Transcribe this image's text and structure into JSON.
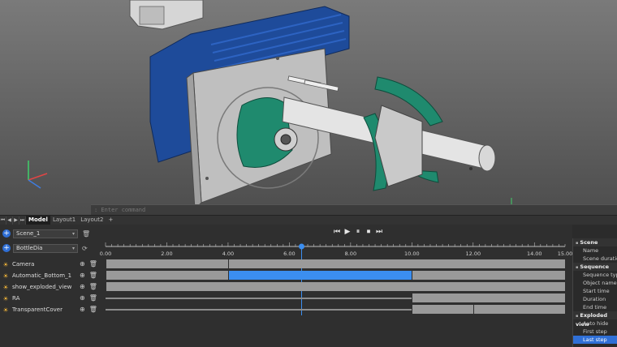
{
  "command_line": {
    "placeholder": ": Enter command"
  },
  "layout_tabs": {
    "nav": [
      "⏮",
      "◀",
      "▶",
      "⏭"
    ],
    "items": [
      "Model",
      "Layout1",
      "Layout2",
      "+"
    ]
  },
  "scene_selector": {
    "value": "Scene_1"
  },
  "sequence_selector": {
    "value": "BottleDia"
  },
  "transport": {
    "first": "⏮",
    "play": "▶",
    "pause": "⏸",
    "stop": "⏹",
    "last": "⏭"
  },
  "timeline": {
    "ticks": [
      "0.00",
      "2.00",
      "4.00",
      "6.00",
      "8.00",
      "10.00",
      "12.00",
      "14.00",
      "15.00"
    ],
    "tick_values": [
      0,
      2,
      4,
      6,
      8,
      10,
      12,
      14,
      15
    ],
    "max": 15,
    "playhead": 6.4
  },
  "tracks": [
    {
      "name": "Camera",
      "style": "bar",
      "segments": [
        [
          0,
          4,
          false
        ],
        [
          4,
          15,
          false
        ]
      ]
    },
    {
      "name": "Automatic_Bottom_1",
      "style": "bar",
      "segments": [
        [
          0,
          4,
          false
        ],
        [
          4,
          10,
          true
        ],
        [
          10,
          15,
          false
        ]
      ]
    },
    {
      "name": "show_exploded_view",
      "style": "bar",
      "segments": [
        [
          0,
          15,
          false
        ]
      ]
    },
    {
      "name": "RA",
      "style": "mixed",
      "segments": [
        [
          10,
          15,
          false
        ]
      ]
    },
    {
      "name": "TransparentCover",
      "style": "mixed",
      "segments": [
        [
          10,
          12,
          false
        ],
        [
          12,
          15,
          false
        ]
      ]
    }
  ],
  "properties": {
    "scene": {
      "title": "Scene",
      "items": [
        "Name",
        "Scene duration"
      ]
    },
    "sequence": {
      "title": "Sequence",
      "items": [
        "Sequence type",
        "Object name",
        "Start time",
        "Duration",
        "End time"
      ]
    },
    "exploded": {
      "title": "Exploded view",
      "items": [
        "Auto hide",
        "First step",
        "Last step"
      ]
    }
  },
  "colors": {
    "accent": "#3b8ef0",
    "part_green": "#1f8a6e",
    "motor_blue": "#1e4b9a"
  }
}
